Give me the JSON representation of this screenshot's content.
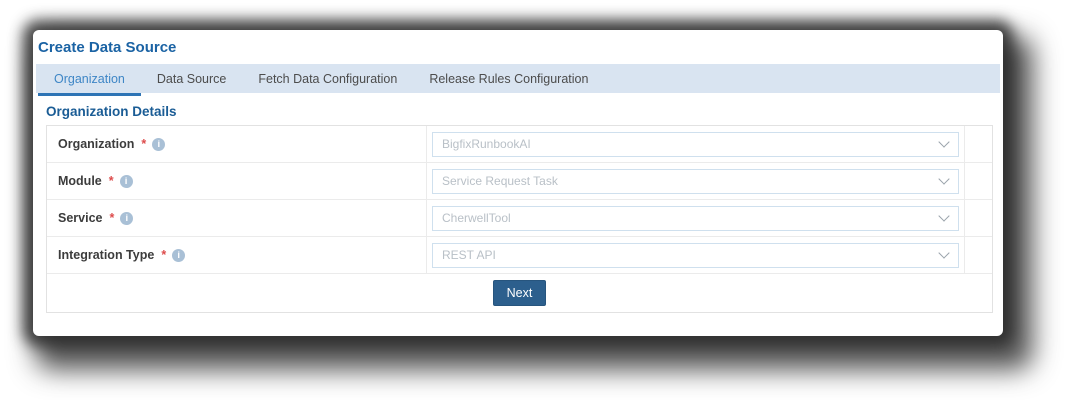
{
  "page": {
    "title": "Create Data Source"
  },
  "tabs": [
    {
      "label": "Organization",
      "active": true
    },
    {
      "label": "Data Source",
      "active": false
    },
    {
      "label": "Fetch Data Configuration",
      "active": false
    },
    {
      "label": "Release Rules Configuration",
      "active": false
    }
  ],
  "section": {
    "heading": "Organization Details"
  },
  "form": {
    "fields": [
      {
        "label": "Organization",
        "required": "*",
        "value": "BigfixRunbookAI"
      },
      {
        "label": "Module",
        "required": "*",
        "value": "Service Request Task"
      },
      {
        "label": "Service",
        "required": "*",
        "value": "CherwellTool"
      },
      {
        "label": "Integration Type",
        "required": "*",
        "value": "REST API"
      }
    ],
    "next_label": "Next"
  },
  "colors": {
    "title_blue": "#1b63a4",
    "section_blue": "#1a5c95",
    "tab_bar_bg": "#d9e4f1",
    "active_tab_text": "#3e86c6",
    "active_tab_underline": "#2e74b5",
    "required_red": "#dd4b4b",
    "select_border": "#cfe0ee",
    "select_text": "#b9c0c7",
    "next_button_bg": "#2c5f8d"
  }
}
